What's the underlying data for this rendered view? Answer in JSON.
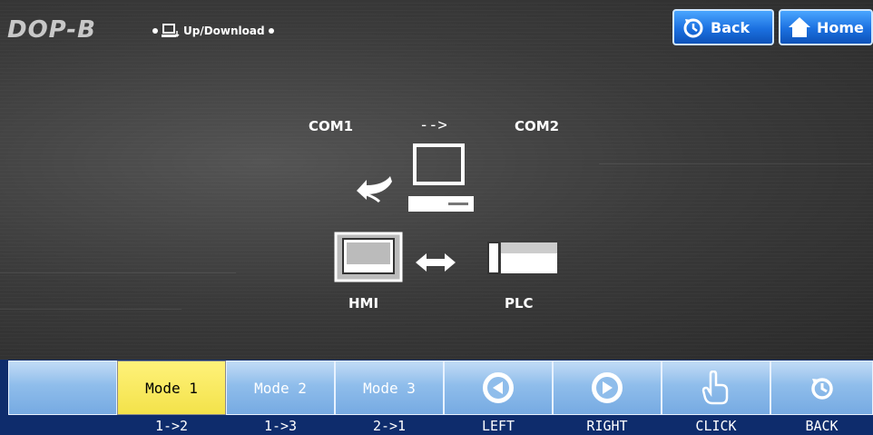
{
  "header": {
    "logo": "DOP-B",
    "path_label": "Up/Download",
    "back_label": "Back",
    "home_label": "Home"
  },
  "diagram": {
    "com_left": "COM1",
    "arrow_text": "-->",
    "com_right": "COM2",
    "hmi_label": "HMI",
    "plc_label": "PLC"
  },
  "toolbar": {
    "buttons": [
      {
        "label": "",
        "sub": ""
      },
      {
        "label": "Mode 1",
        "sub": "1->2"
      },
      {
        "label": "Mode 2",
        "sub": "1->3"
      },
      {
        "label": "Mode 3",
        "sub": "2->1"
      },
      {
        "label": "",
        "sub": "LEFT"
      },
      {
        "label": "",
        "sub": "RIGHT"
      },
      {
        "label": "",
        "sub": "CLICK"
      },
      {
        "label": "",
        "sub": "BACK"
      }
    ],
    "active_index": 1
  },
  "colors": {
    "button_blue": "#8fbdeb",
    "active_yellow": "#f3e24a",
    "bar_navy": "#0e2c6c",
    "top_button_blue": "#1b70e0"
  }
}
